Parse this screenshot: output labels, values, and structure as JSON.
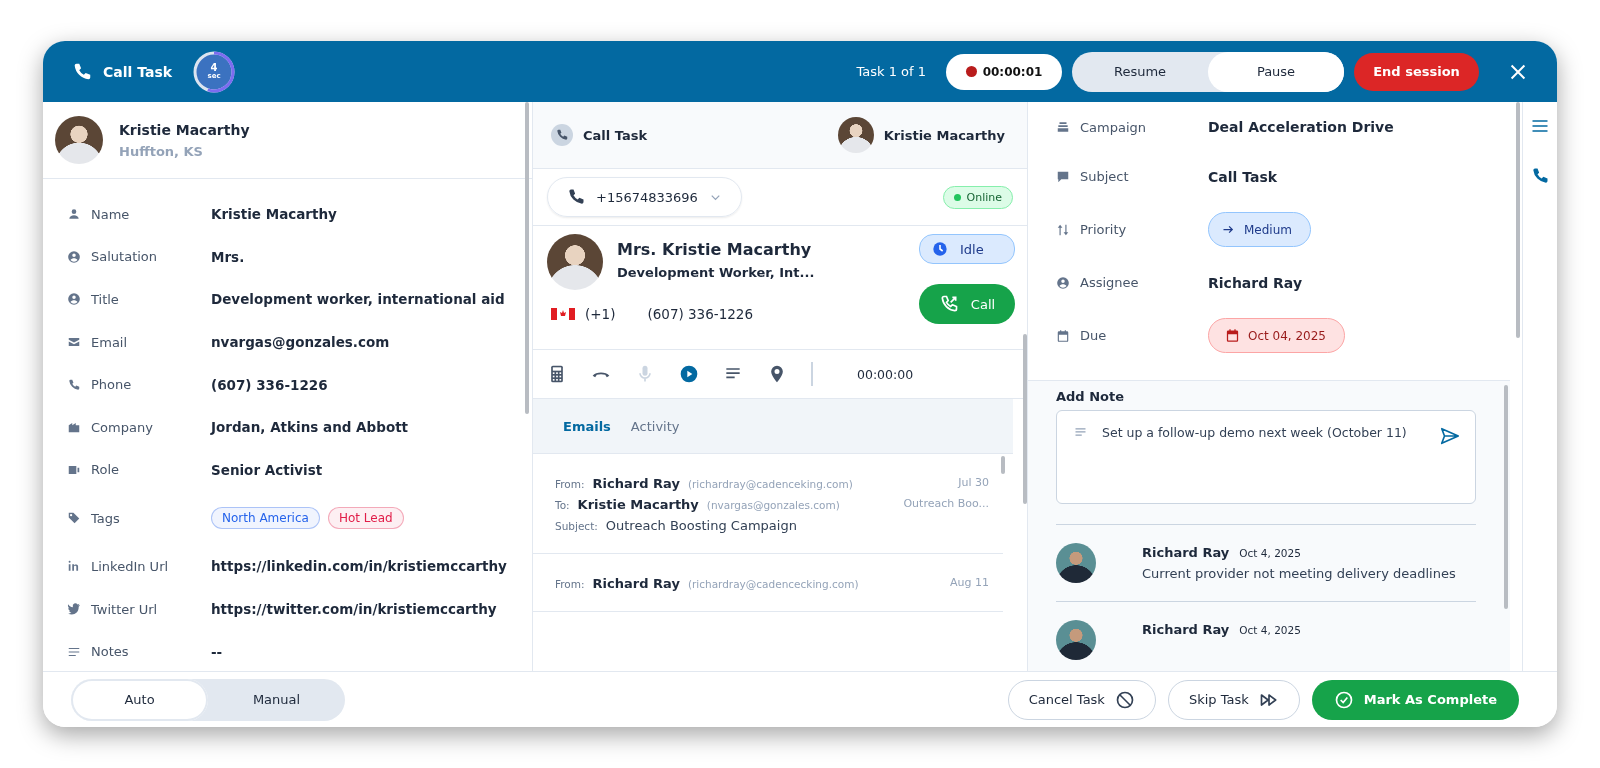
{
  "header": {
    "title": "Call Task",
    "countdown": {
      "value": "4",
      "unit": "sec",
      "level": 0.55
    },
    "task_counter": "Task 1 of 1",
    "recording_time": "00:00:01",
    "mode_toggle": [
      {
        "label": "Resume",
        "selected": false
      },
      {
        "label": "Pause",
        "selected": true
      }
    ],
    "end_button": "End session"
  },
  "contact": {
    "name": "Kristie Macarthy",
    "location": "Huffton, KS",
    "fields": [
      {
        "kind": "text",
        "label": "Name",
        "value": "Kristie Macarthy"
      },
      {
        "kind": "text",
        "label": "Salutation",
        "value": "Mrs."
      },
      {
        "kind": "text",
        "label": "Title",
        "value": "Development worker, international aid"
      },
      {
        "kind": "text",
        "label": "Email",
        "value": "nvargas@gonzales.com"
      },
      {
        "kind": "text",
        "label": "Phone",
        "value": "(607) 336-1226"
      },
      {
        "kind": "text",
        "label": "Company",
        "value": "Jordan, Atkins and Abbott"
      },
      {
        "kind": "text",
        "label": "Role",
        "value": "Senior Activist"
      },
      {
        "kind": "tags",
        "label": "Tags",
        "tags": [
          {
            "label": "North America",
            "color": "#2563eb"
          },
          {
            "label": "Hot Lead",
            "color": "#e11d48"
          }
        ]
      },
      {
        "kind": "text",
        "label": "LinkedIn Url",
        "value": "https://linkedin.com/in/kristiemccarthy"
      },
      {
        "kind": "text",
        "label": "Twitter Url",
        "value": "https://twitter.com/in/kristiemccarthy"
      },
      {
        "kind": "text",
        "label": "Notes",
        "value": "--"
      }
    ]
  },
  "dialer": {
    "title": "Call Task",
    "contact_name": "Kristie Macarthy",
    "from_number": "+15674833696",
    "status": "Online",
    "card": {
      "name": "Mrs. Kristie Macarthy",
      "role": "Development Worker, Int...",
      "country_code": "(+1)",
      "phone": "(607) 336-1226",
      "state": "Idle",
      "call_button": "Call"
    },
    "call_timer": "00:00:00",
    "tabs": [
      {
        "label": "Emails",
        "selected": true
      },
      {
        "label": "Activity",
        "selected": false
      }
    ],
    "emails": [
      {
        "from_label": "From:",
        "from_name": "Richard Ray",
        "from_email": "(richardray@cadenceking.com)",
        "to_label": "To:",
        "to_name": "Kristie Macarthy",
        "to_email": "(nvargas@gonzales.com)",
        "subject_label": "Subject:",
        "subject": "Outreach Boosting Campaign",
        "date": "Jul 30",
        "preview": "Outreach Boo..."
      },
      {
        "from_label": "From:",
        "from_name": "Richard Ray",
        "from_email": "(richardray@cadencecking.com)",
        "date": "Aug 11"
      }
    ]
  },
  "task": {
    "fields": [
      {
        "kind": "text",
        "label": "Campaign",
        "value": "Deal Acceleration Drive"
      },
      {
        "kind": "text",
        "label": "Subject",
        "value": "Call Task"
      },
      {
        "kind": "priority",
        "label": "Priority",
        "value": "Medium"
      },
      {
        "kind": "text",
        "label": "Assignee",
        "value": "Richard Ray"
      },
      {
        "kind": "due",
        "label": "Due",
        "value": "Oct 04, 2025"
      }
    ],
    "add_note": {
      "title": "Add Note",
      "value": "Set up a follow-up demo next week (October 11)"
    },
    "notes": [
      {
        "author": "Richard Ray",
        "date": "Oct 4, 2025",
        "text": "Current provider not meeting delivery deadlines"
      },
      {
        "author": "Richard Ray",
        "date": "Oct 4, 2025"
      }
    ]
  },
  "footer": {
    "mode_toggle": [
      {
        "label": "Auto",
        "selected": true
      },
      {
        "label": "Manual",
        "selected": false
      }
    ],
    "cancel_button": "Cancel Task",
    "skip_button": "Skip Task",
    "complete_button": "Mark As Complete"
  }
}
